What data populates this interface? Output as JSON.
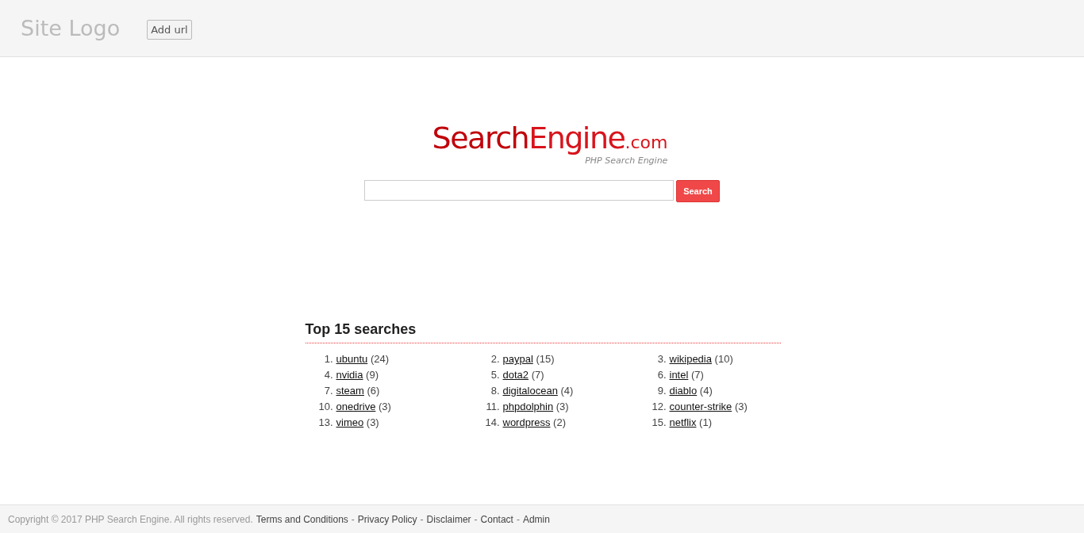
{
  "header": {
    "site_logo": "Site Logo",
    "add_url_button": "Add url"
  },
  "logo": {
    "part_1": "Search",
    "part_2": "Engine",
    "suffix": ".com",
    "tagline": "PHP Search Engine"
  },
  "search": {
    "button": "Search"
  },
  "top_searches": {
    "title": "Top 15 searches",
    "items": [
      {
        "number": "1.",
        "term": "ubuntu",
        "count": "(24)"
      },
      {
        "number": "2.",
        "term": "paypal",
        "count": "(15)"
      },
      {
        "number": "3.",
        "term": "wikipedia",
        "count": "(10)"
      },
      {
        "number": "4.",
        "term": "nvidia",
        "count": "(9)"
      },
      {
        "number": "5.",
        "term": "dota2",
        "count": "(7)"
      },
      {
        "number": "6.",
        "term": "intel",
        "count": "(7)"
      },
      {
        "number": "7.",
        "term": "steam",
        "count": "(6)"
      },
      {
        "number": "8.",
        "term": "digitalocean",
        "count": "(4)"
      },
      {
        "number": "9.",
        "term": "diablo",
        "count": "(4)"
      },
      {
        "number": "10.",
        "term": "onedrive",
        "count": "(3)"
      },
      {
        "number": "11.",
        "term": "phpdolphin",
        "count": "(3)"
      },
      {
        "number": "12.",
        "term": "counter-strike",
        "count": "(3)"
      },
      {
        "number": "13.",
        "term": "vimeo",
        "count": "(3)"
      },
      {
        "number": "14.",
        "term": "wordpress",
        "count": "(2)"
      },
      {
        "number": "15.",
        "term": "netflix",
        "count": "(1)"
      }
    ]
  },
  "footer": {
    "copyright": "Copyright © 2017 PHP Search Engine. All rights reserved.",
    "links": [
      {
        "label": "Terms and Conditions"
      },
      {
        "separator": "-",
        "label": "Privacy Policy"
      },
      {
        "separator": "-",
        "label": "Disclaimer"
      },
      {
        "separator": "-",
        "label": "Contact"
      },
      {
        "separator": "-",
        "label": "Admin"
      }
    ]
  }
}
